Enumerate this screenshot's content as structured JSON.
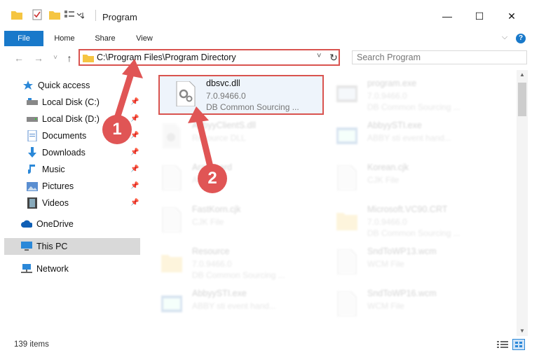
{
  "window": {
    "title": "Program",
    "minimize": "—",
    "maximize": "☐",
    "close": "✕"
  },
  "ribbon": {
    "tabs": [
      "File",
      "Home",
      "Share",
      "View"
    ],
    "expand": "⌵",
    "help": "?"
  },
  "address": {
    "path": "C:\\Program Files\\Program Directory",
    "dropdown": "˅",
    "refresh": "↻"
  },
  "search": {
    "placeholder": "Search Program"
  },
  "nav": {
    "back": "←",
    "forward": "→",
    "history": "˅",
    "up": "↑"
  },
  "sidebar": {
    "quick_access": "Quick access",
    "items": [
      {
        "label": "Local Disk (C:)",
        "pinned": true
      },
      {
        "label": "Local Disk (D:)",
        "pinned": true
      },
      {
        "label": "Documents",
        "pinned": true
      },
      {
        "label": "Downloads",
        "pinned": true
      },
      {
        "label": "Music",
        "pinned": true
      },
      {
        "label": "Pictures",
        "pinned": true
      },
      {
        "label": "Videos",
        "pinned": true
      }
    ],
    "onedrive": "OneDrive",
    "this_pc": "This PC",
    "network": "Network"
  },
  "files": {
    "left": [
      {
        "name": "dbsvc.dll",
        "line2": "7.0.9466.0",
        "line3": "DB Common Sourcing ..."
      },
      {
        "name": "AbbyyClientS.dll",
        "line2": "Resource DLL",
        "line3": ""
      },
      {
        "name": "Arabic.ard",
        "line2": "ARD File",
        "line3": ""
      },
      {
        "name": "FastKorn.cjk",
        "line2": "CJK File",
        "line3": ""
      },
      {
        "name": "Resource",
        "line2": "7.0.9466.0",
        "line3": "DB Common Sourcing ..."
      },
      {
        "name": "AbbyySTI.exe",
        "line2": "ABBY sti event hand...",
        "line3": ""
      }
    ],
    "right": [
      {
        "name": "program.exe",
        "line2": "7.0.9466.0",
        "line3": "DB Common Sourcing ..."
      },
      {
        "name": "AbbyySTI.exe",
        "line2": "ABBY sti event hand...",
        "line3": ""
      },
      {
        "name": "Korean.cjk",
        "line2": "CJK File",
        "line3": ""
      },
      {
        "name": "Microsoft.VC90.CRT",
        "line2": "7.0.9466.0",
        "line3": "DB Common Sourcing ..."
      },
      {
        "name": "SndToWP13.wcm",
        "line2": "WCM File",
        "line3": ""
      },
      {
        "name": "SndToWP16.wcm",
        "line2": "WCM File",
        "line3": ""
      }
    ]
  },
  "status": {
    "count": "139 items"
  },
  "annotations": {
    "step1": "1",
    "step2": "2"
  },
  "colors": {
    "accent": "#1979ca",
    "highlight_border": "#d9534f",
    "badge": "#e05555"
  }
}
